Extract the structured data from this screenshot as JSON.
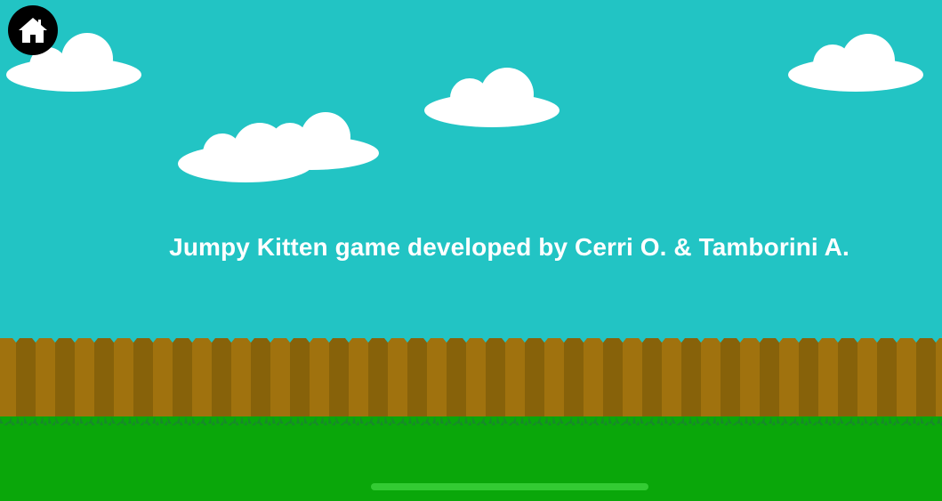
{
  "game": {
    "credits_text": "Jumpy Kitten game developed by Cerri O. & Tamborini A."
  },
  "home_button": {
    "icon": "home-icon"
  },
  "colors": {
    "sky": "#22c4c4",
    "cloud": "#ffffff",
    "fence_light": "#a0720e",
    "fence_dark": "#87620a",
    "grass": "#0aa70a",
    "grass_blades": "#188a2a"
  }
}
